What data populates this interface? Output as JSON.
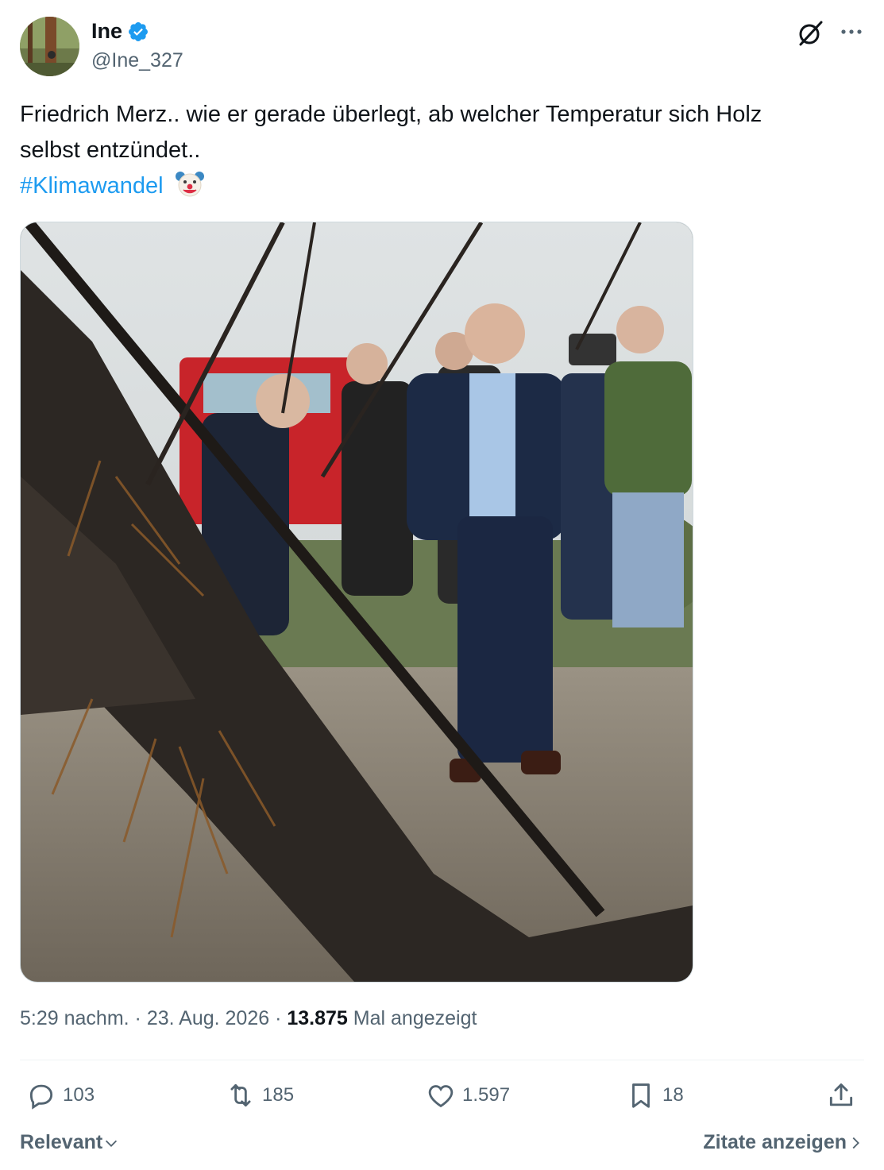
{
  "author": {
    "display_name": "Ine",
    "handle": "@Ine_327",
    "verified": true
  },
  "tweet": {
    "text_line1": "Friedrich Merz.. wie er gerade überlegt, ab welcher Temperatur sich Holz",
    "text_line2": "selbst entzündet..",
    "hashtag": "#Klimawandel",
    "emoji": "clown-face"
  },
  "meta": {
    "time": "5:29 nachm.",
    "separator": "·",
    "date": "23. Aug. 2026",
    "views": "13.875",
    "views_label": "Mal angezeigt"
  },
  "actions": {
    "replies": "103",
    "reposts": "185",
    "likes": "1.597",
    "bookmarks": "18"
  },
  "footer": {
    "sort_label": "Relevant",
    "quotes_label": "Zitate anzeigen"
  },
  "icons": [
    "verified-badge-icon",
    "grok-icon",
    "more-icon",
    "reply-icon",
    "repost-icon",
    "like-icon",
    "bookmark-icon",
    "share-icon",
    "chevron-down-icon",
    "chevron-right-icon"
  ],
  "colors": {
    "accent": "#1d9bf0",
    "text": "#0f1419",
    "secondary": "#536471"
  }
}
